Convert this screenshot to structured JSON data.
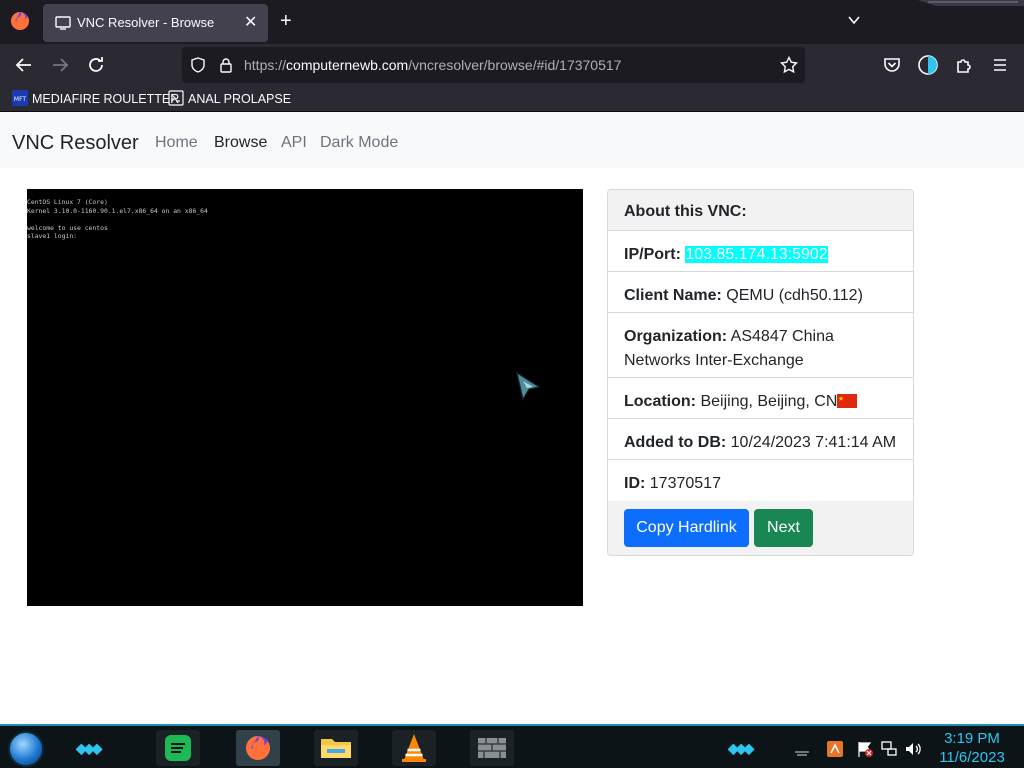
{
  "browser": {
    "tab_title": "VNC Resolver - Browse",
    "url_prefix": "https://",
    "url_host": "computernewb.com",
    "url_path": "/vncresolver/browse/#id/17370517",
    "bookmarks": [
      {
        "label": "MEDIAFIRE ROULETTER",
        "icon": "mediafire-icon"
      },
      {
        "label": "ANAL PROLAPSE",
        "icon": "terminal-icon"
      }
    ]
  },
  "site": {
    "brand": "VNC Resolver",
    "nav": [
      {
        "label": "Home",
        "active": false
      },
      {
        "label": "Browse",
        "active": true
      },
      {
        "label": "API",
        "active": false
      },
      {
        "label": "Dark Mode",
        "active": false
      }
    ]
  },
  "vnc_screen": {
    "lines": [
      "CentOS Linux 7 (Core)",
      "Kernel 3.10.0-1160.90.1.el7.x86_64 on an x86_64",
      "",
      "welcome to use centos",
      "slave1 login:"
    ]
  },
  "info_card": {
    "header": "About this VNC:",
    "ip_label": "IP/Port:",
    "ip_value": "103.85.174.13:5902",
    "client_label": "Client Name:",
    "client_value": "QEMU (cdh50.112)",
    "org_label": "Organization:",
    "org_value": "AS4847 China Networks Inter-Exchange",
    "location_label": "Location:",
    "location_value": "Beijing, Beijing, CN",
    "added_label": "Added to DB:",
    "added_value": "10/24/2023 7:41:14 AM",
    "id_label": "ID:",
    "id_value": "17370517",
    "copy_button": "Copy Hardlink",
    "next_button": "Next"
  },
  "taskbar": {
    "apps": [
      "start-orb",
      "spotify",
      "firefox",
      "file-explorer",
      "vlc",
      "tools"
    ],
    "time": "3:19 PM",
    "date": "11/6/2023"
  },
  "colors": {
    "primary": "#0d6efd",
    "success": "#198754",
    "highlight": "#00ffff",
    "taskbar_accent": "#2ec6f0"
  }
}
